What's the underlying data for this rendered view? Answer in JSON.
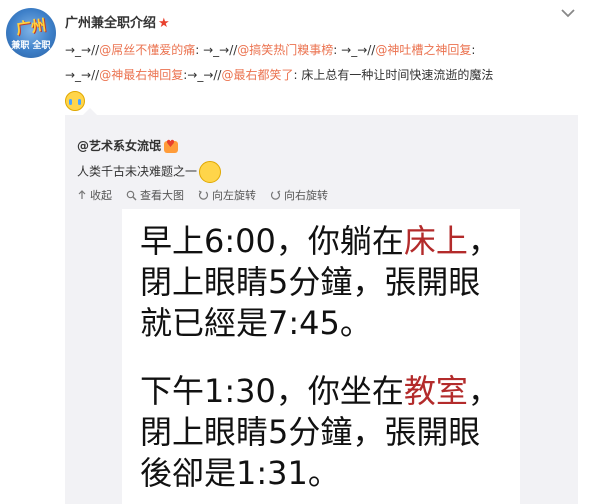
{
  "user": {
    "name": "广州兼全职介绍",
    "avatar_text_top": "广州",
    "avatar_text_bottom": "兼职 全职"
  },
  "post": {
    "segments": [
      {
        "type": "arrow",
        "text": "→_→//"
      },
      {
        "type": "mention",
        "text": "@屌丝不懂爱的痛"
      },
      {
        "type": "plain",
        "text": ": "
      },
      {
        "type": "arrow",
        "text": "→_→//"
      },
      {
        "type": "mention",
        "text": "@搞笑热门糗事榜"
      },
      {
        "type": "plain",
        "text": ": "
      },
      {
        "type": "arrow",
        "text": "→_→//"
      },
      {
        "type": "mention",
        "text": "@神吐槽之神回复"
      },
      {
        "type": "plain",
        "text": ": "
      },
      {
        "type": "arrow",
        "text": "→_→//"
      },
      {
        "type": "mention",
        "text": "@神最右神回复"
      },
      {
        "type": "plain",
        "text": ":"
      },
      {
        "type": "arrow",
        "text": "→_→//"
      },
      {
        "type": "mention",
        "text": "@最右都笑了"
      },
      {
        "type": "plain",
        "text": ": 床上总有一种让时间快速流逝的魔法"
      }
    ]
  },
  "repost": {
    "author": "@艺术系女流氓",
    "text": "人类千古未决难题之一",
    "toolbar": {
      "collapse": "收起",
      "view_large": "查看大图",
      "rotate_left": "向左旋转",
      "rotate_right": "向右旋转"
    },
    "image": {
      "p1_l1a": "早上6:00，你躺在",
      "p1_l1b": "床上",
      "p1_l1c": "，",
      "p1_l2": "閉上眼睛5分鐘，張開眼",
      "p1_l3": "就已經是7:45。",
      "p2_l1a": "下午1:30，你坐在",
      "p2_l1b": "教室",
      "p2_l1c": "，",
      "p2_l2": "閉上眼睛5分鐘，張開眼",
      "p2_l3": "後卻是1:31。"
    }
  },
  "colors": {
    "mention": "#eb7350",
    "repost_bg": "#f2f2f5",
    "highlight_red": "#b32b2b"
  }
}
